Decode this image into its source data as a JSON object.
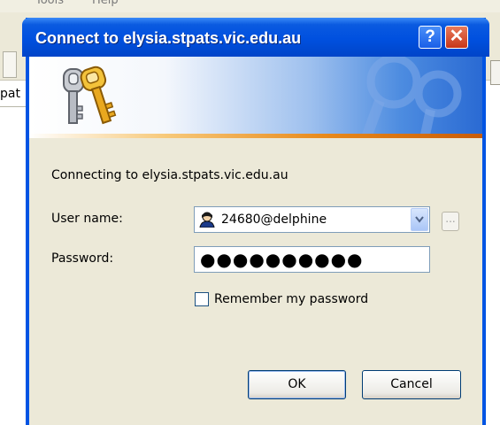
{
  "background_app": {
    "menu": [
      "Tools",
      "Help"
    ],
    "side_text": "pat"
  },
  "dialog": {
    "title": "Connect to elysia.stpats.vic.edu.au",
    "help_glyph": "?",
    "close_glyph": "✕",
    "banner_icon": "keys-icon",
    "connecting_text": "Connecting to elysia.stpats.vic.edu.au",
    "username_label": "User name:",
    "username_value": "24680@delphine",
    "username_icon": "user-icon",
    "browse_glyph": "...",
    "password_label": "Password:",
    "password_masked": "●●●●●●●●●●",
    "remember_label": "Remember my password",
    "remember_checked": false,
    "ok_label": "OK",
    "cancel_label": "Cancel"
  },
  "colors": {
    "titlebar": "#0054e3",
    "dialog_bg": "#ece9d8",
    "close_button": "#c8361a"
  }
}
